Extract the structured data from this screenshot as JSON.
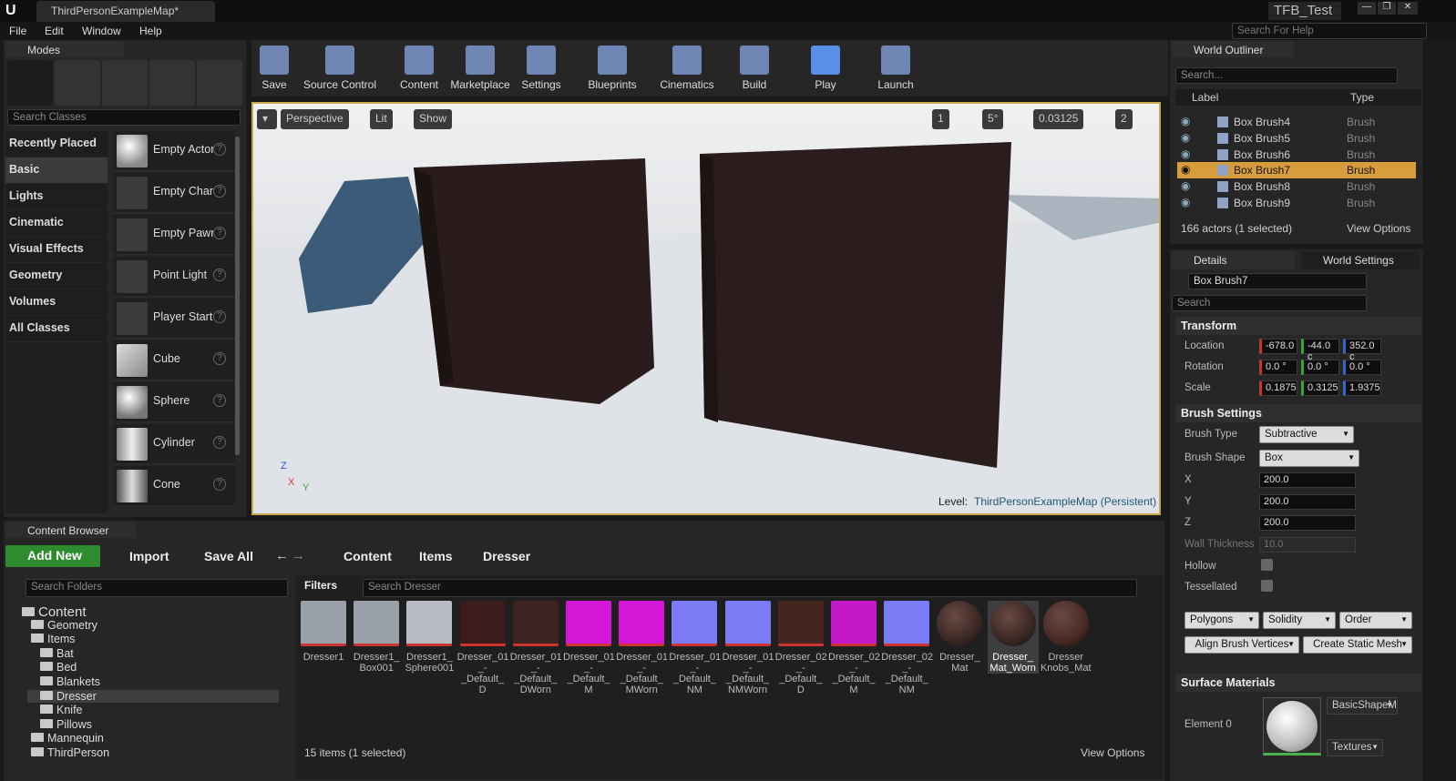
{
  "window": {
    "tab_title": "ThirdPersonExampleMap*",
    "project_name": "TFB_Test",
    "help_search_placeholder": "Search For Help"
  },
  "menu": [
    "File",
    "Edit",
    "Window",
    "Help"
  ],
  "modes": {
    "tab": "Modes",
    "search_placeholder": "Search Classes",
    "categories": [
      "Recently Placed",
      "Basic",
      "Lights",
      "Cinematic",
      "Visual Effects",
      "Geometry",
      "Volumes",
      "All Classes"
    ],
    "classes": [
      "Empty Actor",
      "Empty Character",
      "Empty Pawn",
      "Point Light",
      "Player Start",
      "Cube",
      "Sphere",
      "Cylinder",
      "Cone"
    ]
  },
  "toolbar": [
    {
      "label": "Save",
      "icon": "save-icon"
    },
    {
      "label": "Source Control",
      "icon": "source-control-icon"
    },
    {
      "label": "Content",
      "icon": "content-icon"
    },
    {
      "label": "Marketplace",
      "icon": "marketplace-icon"
    },
    {
      "label": "Settings",
      "icon": "settings-icon"
    },
    {
      "label": "Blueprints",
      "icon": "blueprints-icon"
    },
    {
      "label": "Cinematics",
      "icon": "cinematics-icon"
    },
    {
      "label": "Build",
      "icon": "build-icon"
    },
    {
      "label": "Play",
      "icon": "play-icon"
    },
    {
      "label": "Launch",
      "icon": "launch-icon"
    }
  ],
  "viewport": {
    "perspective": "Perspective",
    "lit": "Lit",
    "show": "Show",
    "grid_snap": "1",
    "rotation_snap": "5°",
    "scale_snap": "0.03125",
    "camera_speed": "2",
    "level_label": "Level:",
    "level_name": "ThirdPersonExampleMap (Persistent)",
    "axis_z": "Z",
    "axis_x": "X",
    "axis_y": "Y"
  },
  "outliner": {
    "tab": "World Outliner",
    "search_placeholder": "Search...",
    "col_label": "Label",
    "col_type": "Type",
    "rows": [
      {
        "label": "Box Brush4",
        "type": "Brush",
        "selected": false
      },
      {
        "label": "Box Brush5",
        "type": "Brush",
        "selected": false
      },
      {
        "label": "Box Brush6",
        "type": "Brush",
        "selected": false
      },
      {
        "label": "Box Brush7",
        "type": "Brush",
        "selected": true
      },
      {
        "label": "Box Brush8",
        "type": "Brush",
        "selected": false
      },
      {
        "label": "Box Brush9",
        "type": "Brush",
        "selected": false
      }
    ],
    "status": "166 actors (1 selected)",
    "view_options": "View Options"
  },
  "details": {
    "tab": "Details",
    "tab2": "World Settings",
    "name": "Box Brush7",
    "search_placeholder": "Search",
    "transform": "Transform",
    "location_label": "Location",
    "location": [
      "-678.0",
      "-44.0 c",
      "352.0 c"
    ],
    "rotation_label": "Rotation",
    "rotation": [
      "0.0 °",
      "0.0 °",
      "0.0 °"
    ],
    "scale_label": "Scale",
    "scale": [
      "0.1875",
      "0.3125",
      "1.9375"
    ],
    "brush_settings": "Brush Settings",
    "brush_type_label": "Brush Type",
    "brush_type": "Subtractive",
    "brush_shape_label": "Brush Shape",
    "brush_shape": "Box",
    "x_label": "X",
    "x": "200.0",
    "y_label": "Y",
    "y": "200.0",
    "z_label": "Z",
    "z": "200.0",
    "wall_label": "Wall Thickness",
    "wall": "10.0",
    "hollow_label": "Hollow",
    "tess_label": "Tessellated",
    "polygons": "Polygons",
    "solidity": "Solidity",
    "order": "Order",
    "align_btn": "Align Brush Vertices",
    "static_btn": "Create Static Mesh",
    "surface_materials": "Surface Materials",
    "element_label": "Element 0",
    "material": "BasicShapeM",
    "textures": "Textures"
  },
  "content_browser": {
    "tab": "Content Browser",
    "add_new": "Add New",
    "import": "Import",
    "save_all": "Save All",
    "breadcrumb": [
      "Content",
      "Items",
      "Dresser"
    ],
    "folder_search_placeholder": "Search Folders",
    "filters": "Filters",
    "asset_search_placeholder": "Search Dresser",
    "folders": [
      {
        "name": "Content",
        "level": 0
      },
      {
        "name": "Geometry",
        "level": 1
      },
      {
        "name": "Items",
        "level": 1
      },
      {
        "name": "Bat",
        "level": 2
      },
      {
        "name": "Bed",
        "level": 2
      },
      {
        "name": "Blankets",
        "level": 2
      },
      {
        "name": "Dresser",
        "level": 2
      },
      {
        "name": "Knife",
        "level": 2
      },
      {
        "name": "Pillows",
        "level": 2
      },
      {
        "name": "Mannequin",
        "level": 1
      },
      {
        "name": "ThirdPerson",
        "level": 1
      }
    ],
    "assets": [
      {
        "name": "Dresser1",
        "color": "#9aa0a8"
      },
      {
        "name": "Dresser1_ Box001",
        "color": "#9aa0a8"
      },
      {
        "name": "Dresser1_ Sphere001",
        "color": "#b8bcc2"
      },
      {
        "name": "Dresser_01 _-_Default_ D",
        "color": "#3a1d1a"
      },
      {
        "name": "Dresser_01 _-_Default_ DWorn",
        "color": "#3d2420"
      },
      {
        "name": "Dresser_01 _-_Default_ M",
        "color": "#d516d6"
      },
      {
        "name": "Dresser_01 _-_Default_ MWorn",
        "color": "#d516d6"
      },
      {
        "name": "Dresser_01 _-_Default_ NM",
        "color": "#7b7bf5"
      },
      {
        "name": "Dresser_01 _-_Default_ NMWorn",
        "color": "#7b7bf5"
      },
      {
        "name": "Dresser_02 _-_Default_ D",
        "color": "#452520"
      },
      {
        "name": "Dresser_02 _-_Default_ M",
        "color": "#c418c9"
      },
      {
        "name": "Dresser_02 _-_Default_ NM",
        "color": "#7b7bf5"
      },
      {
        "name": "Dresser_ Mat",
        "color": "#3a2723"
      },
      {
        "name": "Dresser_ Mat_Worn",
        "color": "#3a2723"
      },
      {
        "name": "Dresser Knobs_Mat",
        "color": "#4a2a24"
      }
    ],
    "status": "15 items (1 selected)",
    "view_options": "View Options"
  }
}
